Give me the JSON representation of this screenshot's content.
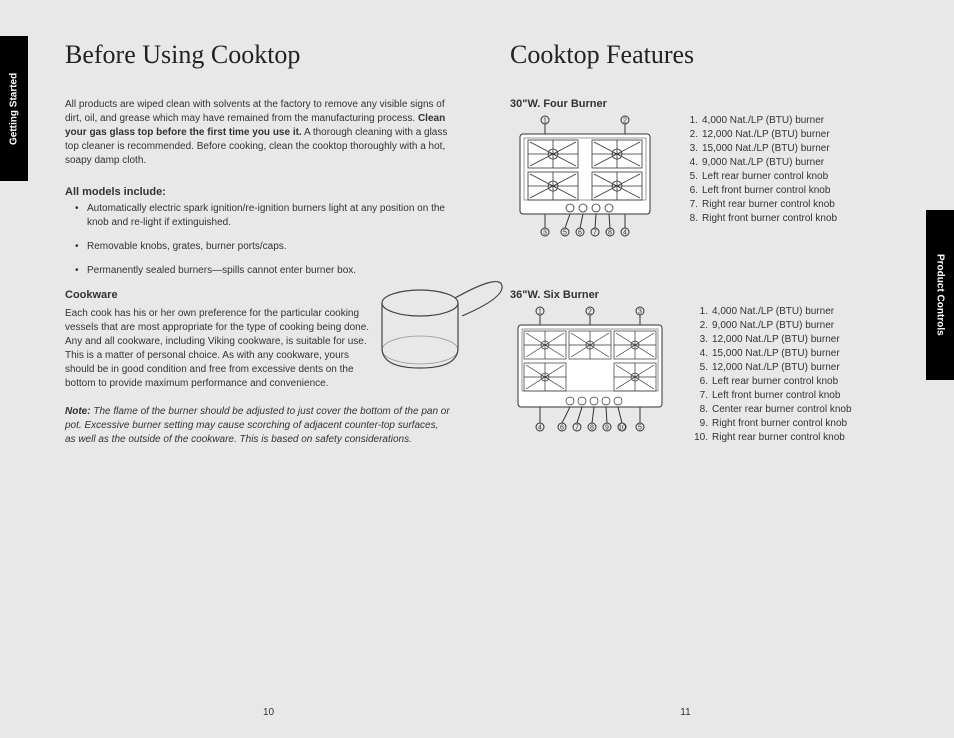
{
  "tabs": {
    "left": "Getting Started",
    "right": "Product Controls"
  },
  "left_page": {
    "title": "Before Using Cooktop",
    "intro_prefix": "All products are wiped clean with solvents at the factory to remove any visible signs of dirt, oil, and grease which may have remained from the manufacturing process. ",
    "intro_bold": "Clean your gas glass top before the first time you use it.",
    "intro_suffix": " A thorough cleaning with a glass top cleaner is recommended. Before cooking, clean the cooktop thoroughly with a hot, soapy damp cloth.",
    "models_heading": "All models include:",
    "models_bullets": [
      "Automatically electric spark ignition/re-ignition burners light at any position on the knob and re-light if extinguished.",
      "Removable knobs, grates, burner ports/caps.",
      "Permanently sealed burners—spills cannot enter burner box."
    ],
    "cookware_heading": "Cookware",
    "cookware_body": "Each cook has his or her own preference for the particular cooking vessels that are most appropriate for the type of cooking being done. Any and all cookware, including Viking cookware, is suitable for use. This is a matter of personal choice. As with any cookware, yours should be in good condition and free from excessive dents on the bottom to provide maximum performance and convenience.",
    "note_label": "Note:",
    "note_body": " The flame of the burner should be adjusted to just cover the bottom of the pan or pot. Excessive burner setting may cause scorching of adjacent counter-top surfaces, as well as the outside of the cookware. This is based on safety considerations.",
    "page_number": "10"
  },
  "right_page": {
    "title": "Cooktop Features",
    "four_burner": {
      "heading": "30\"W. Four Burner",
      "legend": [
        {
          "n": "1.",
          "t": "4,000 Nat./LP (BTU) burner"
        },
        {
          "n": "2.",
          "t": "12,000 Nat./LP (BTU) burner"
        },
        {
          "n": "3.",
          "t": "15,000 Nat./LP (BTU) burner"
        },
        {
          "n": "4.",
          "t": "9,000 Nat./LP (BTU) burner"
        },
        {
          "n": "5.",
          "t": "Left rear burner control knob"
        },
        {
          "n": "6.",
          "t": "Left front burner control knob"
        },
        {
          "n": "7.",
          "t": "Right rear burner control knob"
        },
        {
          "n": "8.",
          "t": "Right front burner control knob"
        }
      ]
    },
    "six_burner": {
      "heading": "36\"W. Six Burner",
      "legend": [
        {
          "n": "1.",
          "t": "4,000 Nat./LP (BTU) burner"
        },
        {
          "n": "2.",
          "t": "9,000 Nat./LP (BTU) burner"
        },
        {
          "n": "3.",
          "t": "12,000 Nat./LP (BTU) burner"
        },
        {
          "n": "4.",
          "t": "15,000 Nat./LP (BTU) burner"
        },
        {
          "n": "5.",
          "t": "12,000 Nat./LP (BTU)  burner"
        },
        {
          "n": "6.",
          "t": "Left rear burner control knob"
        },
        {
          "n": "7.",
          "t": "Left front burner control knob"
        },
        {
          "n": "8.",
          "t": "Center rear burner control knob"
        },
        {
          "n": "9.",
          "t": "Right front burner control knob"
        },
        {
          "n": "10.",
          "t": "Right rear burner control knob"
        }
      ]
    },
    "page_number": "11"
  }
}
